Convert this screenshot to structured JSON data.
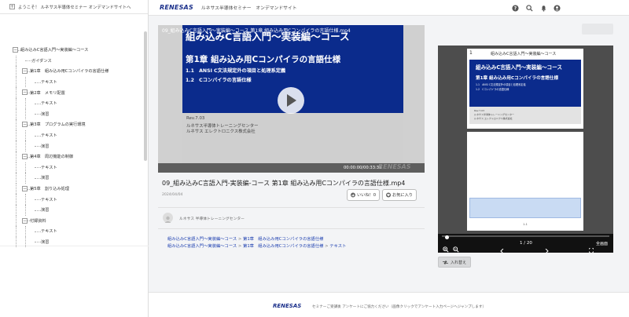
{
  "sidebar": {
    "header_label": "ようこそ！ ルネサス半導体セミナー オンデマンドサイトへ",
    "tree": [
      {
        "label": "組み込みC言語入門〜実装編〜コース",
        "level": 0,
        "toggle": "−"
      },
      {
        "label": "ガイダンス",
        "level": 1
      },
      {
        "label": "第1章　組み込み用Cコンパイラの言語仕様",
        "level": 1,
        "toggle": "−"
      },
      {
        "label": "テキスト",
        "level": 2
      },
      {
        "label": "第2章　メモリ配置",
        "level": 1,
        "toggle": "−"
      },
      {
        "label": "テキスト",
        "level": 2
      },
      {
        "label": "演習",
        "level": 2
      },
      {
        "label": "第3章　プログラムの実行環境",
        "level": 1,
        "toggle": "−"
      },
      {
        "label": "テキスト",
        "level": 2
      },
      {
        "label": "演習",
        "level": 2
      },
      {
        "label": "第4章　周辺機能の制御",
        "level": 1,
        "toggle": "−"
      },
      {
        "label": "テキスト",
        "level": 2
      },
      {
        "label": "演習",
        "level": 2
      },
      {
        "label": "第5章　割り込み処理",
        "level": 1,
        "toggle": "−"
      },
      {
        "label": "テキスト",
        "level": 2
      },
      {
        "label": "演習",
        "level": 2
      },
      {
        "label": "付録資料",
        "level": 1,
        "toggle": "−"
      },
      {
        "label": "テキスト",
        "level": 2
      },
      {
        "label": "演習",
        "level": 2
      }
    ]
  },
  "header": {
    "logo": "RENESAS",
    "site_title": "ルネサス半導体セミナー　オンデマンドサイト",
    "icons": [
      "help-icon",
      "search-icon",
      "bell-icon",
      "user-icon"
    ]
  },
  "video": {
    "overlay_title": "09_組み込みC言語入門〜実装編〜コース 第1章 組み込み用Cコンパイラの言語仕様.mp4",
    "slide_title": "組み込みC言語入門〜実装編〜コース",
    "slide_chapter": "第1章 組み込み用Cコンパイラの言語仕様",
    "slide_section1": "1.1　ANSI C文法規定外の項目と処理系定義",
    "slide_section2": "1.2　Cコンパイラの言語仕様",
    "slide_rev": "Rev.7.03",
    "slide_center": "ルネサス半導体トレーニングセンター",
    "slide_company": "ルネサス エレクトロニクス株式会社",
    "time": "00:00:00/00:33:39",
    "watermark": "RENESAS",
    "title": "09_組み込みC言語入門-実装編-コース 第1章 組み込み用Cコンパイラの言語仕様.mp4",
    "date": "2024/04/04",
    "like_label": "いいね！0",
    "favorite_label": "お気に入り",
    "author": "ルネサス 半導体トレーニングセンター"
  },
  "breadcrumbs": {
    "line1": [
      "組み込みC言語入門〜実装編〜コース",
      "第1章　組み込み用Cコンパイラの言語仕様"
    ],
    "line2": [
      "組み込みC言語入門〜実装編〜コース",
      "第1章　組み込み用Cコンパイラの言語仕様",
      "テキスト"
    ],
    "separator": ">"
  },
  "document": {
    "page1_num": "1",
    "page1_header": "組み込みC言語入門〜実装編〜コース",
    "page1_title": "組み込みC言語入門〜実装編〜コース",
    "page1_chapter": "第1章 組み込み用Cコンパイラの言語仕様",
    "page2_num": "1-1",
    "page_indicator": "1 / 20",
    "fullscreen_label": "全画面",
    "progress": 0.02
  },
  "switch_label": "入れ替え",
  "footer": {
    "logo": "RENESAS",
    "text": "セミナーご受講後 アンケートにご協力ください（画像クリックでアンケート入力ページへジャンプします）"
  },
  "colors": {
    "brand": "#1a2f8a",
    "slide_blue": "#0b2b8c",
    "link": "#1d3fb0"
  }
}
